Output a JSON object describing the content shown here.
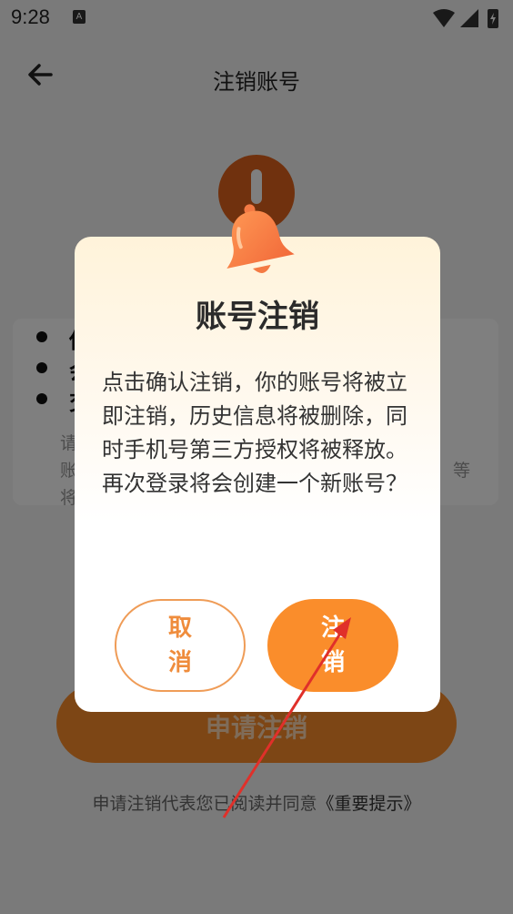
{
  "status_bar": {
    "time": "9:28",
    "notification_glyph": "A"
  },
  "app_bar": {
    "title": "注销账号",
    "back_icon": "arrow-left-icon"
  },
  "page": {
    "bullets": [
      "你",
      "会",
      "交"
    ],
    "card_lines": [
      "请",
      "账",
      "将"
    ],
    "card_line_tail": "等",
    "apply_button": "申请注销",
    "agreement_prefix": "申请注销代表您已阅读并同意",
    "agreement_link": "《重要提示》"
  },
  "dialog": {
    "title": "账号注销",
    "body_line1": "点击确认注销，你的账号将被立即注销，历史信息将被删除，同时手机号第三方授权将被释放。",
    "body_line2": "再次登录将会创建一个新账号？",
    "cancel_label": "取消",
    "confirm_label": "注销"
  },
  "colors": {
    "accent": "#fa8d2b",
    "overlay": "#000000",
    "annotation_arrow": "#e0302a"
  }
}
